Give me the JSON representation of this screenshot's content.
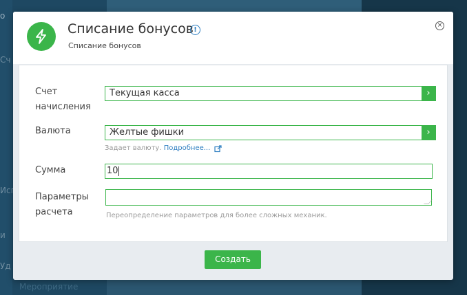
{
  "background": {
    "fragments": [
      "о",
      "Сч",
      "Исп",
      "и",
      "Уд",
      "Мероприятие"
    ]
  },
  "dialog": {
    "title": "Списание бонусов",
    "subtitle": "Списание бонусов",
    "icon": "lightning-icon",
    "info_icon_glyph": "!",
    "close_icon_glyph": "×",
    "accent_color": "#3bb54a"
  },
  "form": {
    "account": {
      "label_line1": "Счет",
      "label_line2": "начисления",
      "value": "Текущая касса",
      "arrow": "›"
    },
    "currency": {
      "label": "Валюта",
      "value": "Желтые фишки",
      "arrow": "›",
      "hint": "Задает валюту.",
      "hint_link": "Подробнее..."
    },
    "amount": {
      "label": "Сумма",
      "value": "10"
    },
    "params": {
      "label_line1": "Параметры",
      "label_line2": "расчета",
      "value": "",
      "hint": "Переопределение параметров для более сложных механик."
    }
  },
  "footer": {
    "create_label": "Создать"
  }
}
